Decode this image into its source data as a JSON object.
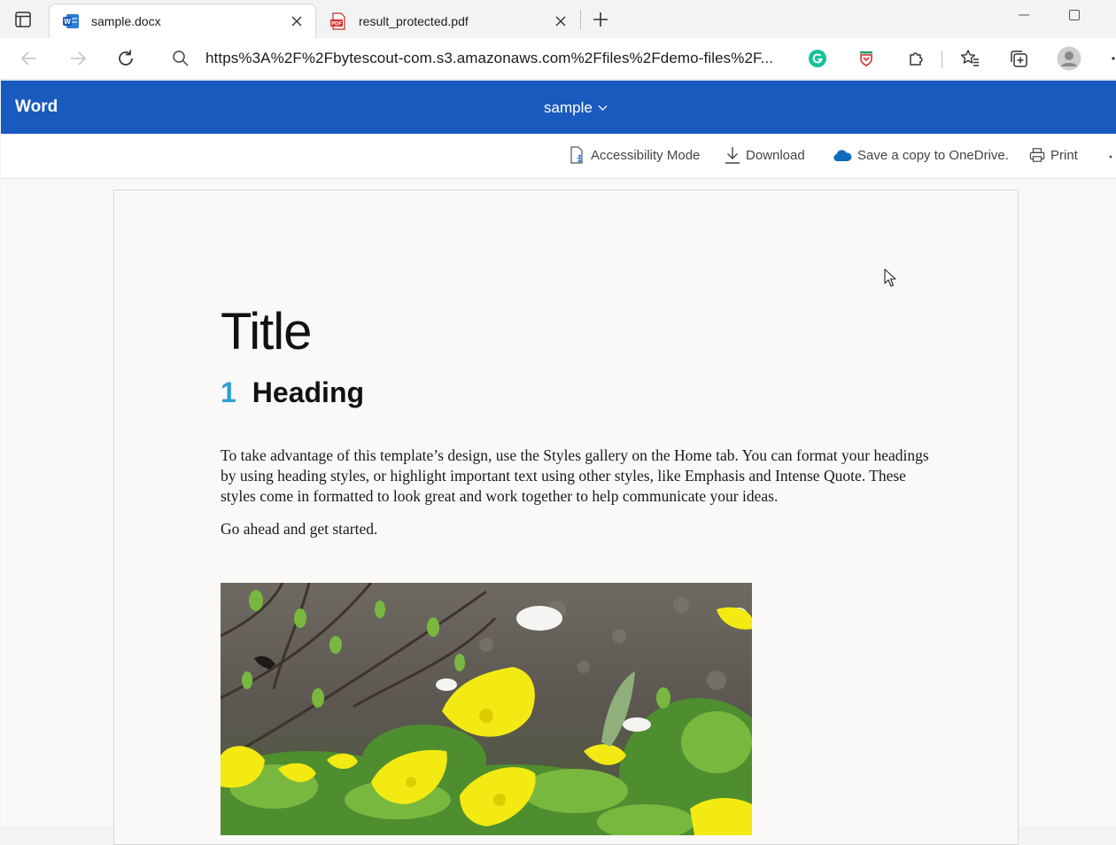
{
  "browser": {
    "tabs": [
      {
        "title": "sample.docx",
        "icon": "word-icon",
        "active": true
      },
      {
        "title": "result_protected.pdf",
        "icon": "pdf-icon",
        "active": false
      }
    ],
    "address": "https%3A%2F%2Fbytescout-com.s3.amazonaws.com%2Ffiles%2Fdemo-files%2F..."
  },
  "word": {
    "app_name": "Word",
    "doc_name": "sample",
    "commands": {
      "accessibility": "Accessibility Mode",
      "download": "Download",
      "save_copy": "Save a copy to OneDrive.",
      "print": "Print"
    }
  },
  "document": {
    "title": "Title",
    "heading_number": "1",
    "heading_text": "Heading",
    "paragraph1": "To take advantage of this template’s design, use the Styles gallery on the Home tab. You can format your headings by using heading styles, or highlight important text using other styles, like Emphasis and Intense Quote. These styles come in formatted to look great and work together to help communicate your ideas.",
    "paragraph2": "Go ahead and get started."
  },
  "colors": {
    "word_blue": "#185abd",
    "heading_number": "#2f9fd8",
    "grammarly_green": "#15c39a"
  }
}
